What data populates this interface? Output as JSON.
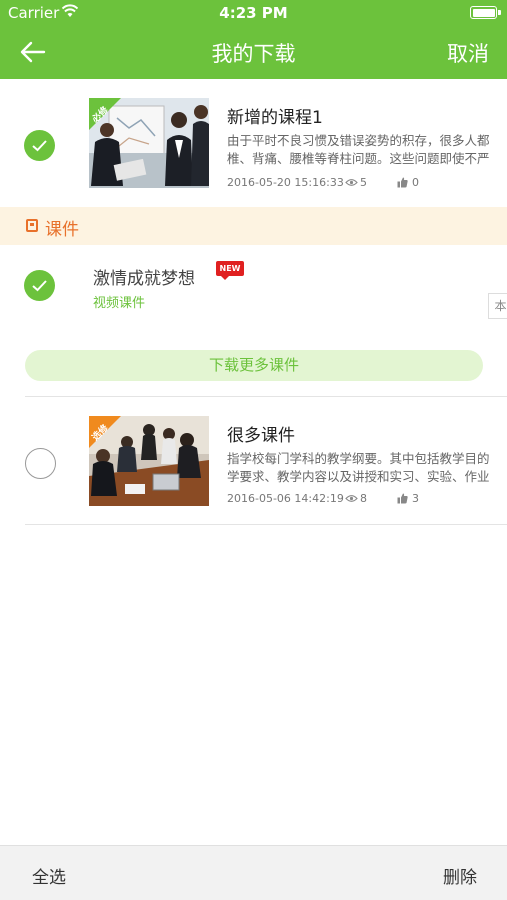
{
  "status_bar": {
    "carrier": "Carrier",
    "time": "4:23 PM"
  },
  "header": {
    "title": "我的下载",
    "cancel_label": "取消",
    "bg_color": "#6cc23c"
  },
  "courses": [
    {
      "title": "新增的课程1",
      "badge": "必修",
      "desc_line1": "由于平时不良习惯及错误姿势的积存，很多人都",
      "desc_line2": "椎、背痛、腰椎等脊柱问题。这些问题即使不严",
      "date": "2016-05-20 15:16:33",
      "views": "5",
      "likes": "0",
      "checked": true
    },
    {
      "title": "很多课件",
      "badge": "选修",
      "desc_line1": "指学校每门学科的教学纲要。其中包括教学目的",
      "desc_line2": "学要求、教学内容以及讲授和实习、实验、作业",
      "date": "2016-05-06 14:42:19",
      "views": "8",
      "likes": "3",
      "checked": false
    }
  ],
  "section": {
    "label": "课件",
    "color": "#e8712b"
  },
  "courseware": {
    "title": "激情成就梦想",
    "new_badge": "NEW",
    "type": "视频课件",
    "side_tab": "本",
    "checked": true
  },
  "more_button": {
    "label": "下载更多课件"
  },
  "bottom_bar": {
    "select_all_label": "全选",
    "delete_label": "删除"
  }
}
